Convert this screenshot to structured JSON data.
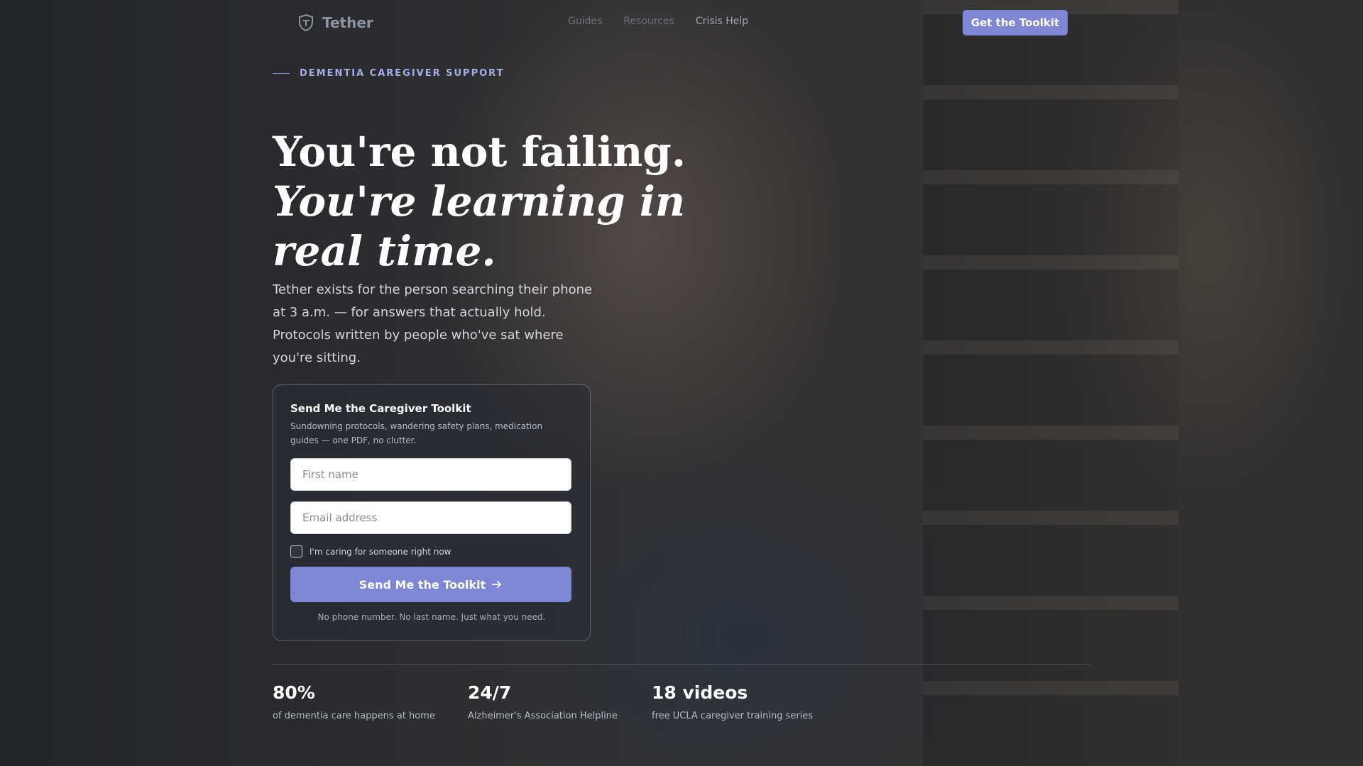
{
  "header": {
    "brand": "Tether",
    "nav_links": [
      {
        "label": "Guides"
      },
      {
        "label": "Resources"
      },
      {
        "label": "Crisis Help"
      }
    ],
    "cta_label": "Get the Toolkit"
  },
  "hero": {
    "eyebrow": "DEMENTIA CAREGIVER SUPPORT",
    "headline_line1": "You're not failing.",
    "headline_line2": "You're learning in real time.",
    "lead": "Tether exists for the person searching their phone at 3 a.m. — for answers that actually hold. Protocols written by people who've sat where you're sitting."
  },
  "form": {
    "title": "Send Me the Caregiver Toolkit",
    "subtitle": "Sundowning protocols, wandering safety plans, medication guides — one PDF, no clutter.",
    "first_name_placeholder": "First name",
    "email_placeholder": "Email address",
    "checkbox_label": "I'm caring for someone right now",
    "submit_label": "Send Me the Toolkit",
    "footnote": "No phone number. No last name. Just what you need."
  },
  "stats": [
    {
      "value": "80%",
      "label": "of dementia care happens at home"
    },
    {
      "value": "24/7",
      "label": "Alzheimer's Association Helpline"
    },
    {
      "value": "18 videos",
      "label": "free UCLA caregiver training series"
    }
  ],
  "colors": {
    "accent": "#7e86d6",
    "eyebrow": "#a8aee8"
  },
  "icons": {
    "logo": "shield-icon",
    "submit": "arrow-right-icon"
  }
}
